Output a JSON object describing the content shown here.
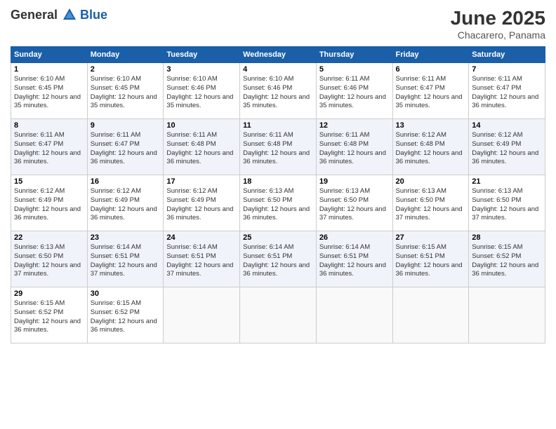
{
  "header": {
    "logo": {
      "general": "General",
      "blue": "Blue"
    },
    "title": "June 2025",
    "location": "Chacarero, Panama"
  },
  "columns": [
    "Sunday",
    "Monday",
    "Tuesday",
    "Wednesday",
    "Thursday",
    "Friday",
    "Saturday"
  ],
  "weeks": [
    [
      {
        "day": "1",
        "sunrise": "Sunrise: 6:10 AM",
        "sunset": "Sunset: 6:45 PM",
        "daylight": "Daylight: 12 hours and 35 minutes."
      },
      {
        "day": "2",
        "sunrise": "Sunrise: 6:10 AM",
        "sunset": "Sunset: 6:45 PM",
        "daylight": "Daylight: 12 hours and 35 minutes."
      },
      {
        "day": "3",
        "sunrise": "Sunrise: 6:10 AM",
        "sunset": "Sunset: 6:46 PM",
        "daylight": "Daylight: 12 hours and 35 minutes."
      },
      {
        "day": "4",
        "sunrise": "Sunrise: 6:10 AM",
        "sunset": "Sunset: 6:46 PM",
        "daylight": "Daylight: 12 hours and 35 minutes."
      },
      {
        "day": "5",
        "sunrise": "Sunrise: 6:11 AM",
        "sunset": "Sunset: 6:46 PM",
        "daylight": "Daylight: 12 hours and 35 minutes."
      },
      {
        "day": "6",
        "sunrise": "Sunrise: 6:11 AM",
        "sunset": "Sunset: 6:47 PM",
        "daylight": "Daylight: 12 hours and 35 minutes."
      },
      {
        "day": "7",
        "sunrise": "Sunrise: 6:11 AM",
        "sunset": "Sunset: 6:47 PM",
        "daylight": "Daylight: 12 hours and 36 minutes."
      }
    ],
    [
      {
        "day": "8",
        "sunrise": "Sunrise: 6:11 AM",
        "sunset": "Sunset: 6:47 PM",
        "daylight": "Daylight: 12 hours and 36 minutes."
      },
      {
        "day": "9",
        "sunrise": "Sunrise: 6:11 AM",
        "sunset": "Sunset: 6:47 PM",
        "daylight": "Daylight: 12 hours and 36 minutes."
      },
      {
        "day": "10",
        "sunrise": "Sunrise: 6:11 AM",
        "sunset": "Sunset: 6:48 PM",
        "daylight": "Daylight: 12 hours and 36 minutes."
      },
      {
        "day": "11",
        "sunrise": "Sunrise: 6:11 AM",
        "sunset": "Sunset: 6:48 PM",
        "daylight": "Daylight: 12 hours and 36 minutes."
      },
      {
        "day": "12",
        "sunrise": "Sunrise: 6:11 AM",
        "sunset": "Sunset: 6:48 PM",
        "daylight": "Daylight: 12 hours and 36 minutes."
      },
      {
        "day": "13",
        "sunrise": "Sunrise: 6:12 AM",
        "sunset": "Sunset: 6:48 PM",
        "daylight": "Daylight: 12 hours and 36 minutes."
      },
      {
        "day": "14",
        "sunrise": "Sunrise: 6:12 AM",
        "sunset": "Sunset: 6:49 PM",
        "daylight": "Daylight: 12 hours and 36 minutes."
      }
    ],
    [
      {
        "day": "15",
        "sunrise": "Sunrise: 6:12 AM",
        "sunset": "Sunset: 6:49 PM",
        "daylight": "Daylight: 12 hours and 36 minutes."
      },
      {
        "day": "16",
        "sunrise": "Sunrise: 6:12 AM",
        "sunset": "Sunset: 6:49 PM",
        "daylight": "Daylight: 12 hours and 36 minutes."
      },
      {
        "day": "17",
        "sunrise": "Sunrise: 6:12 AM",
        "sunset": "Sunset: 6:49 PM",
        "daylight": "Daylight: 12 hours and 36 minutes."
      },
      {
        "day": "18",
        "sunrise": "Sunrise: 6:13 AM",
        "sunset": "Sunset: 6:50 PM",
        "daylight": "Daylight: 12 hours and 36 minutes."
      },
      {
        "day": "19",
        "sunrise": "Sunrise: 6:13 AM",
        "sunset": "Sunset: 6:50 PM",
        "daylight": "Daylight: 12 hours and 37 minutes."
      },
      {
        "day": "20",
        "sunrise": "Sunrise: 6:13 AM",
        "sunset": "Sunset: 6:50 PM",
        "daylight": "Daylight: 12 hours and 37 minutes."
      },
      {
        "day": "21",
        "sunrise": "Sunrise: 6:13 AM",
        "sunset": "Sunset: 6:50 PM",
        "daylight": "Daylight: 12 hours and 37 minutes."
      }
    ],
    [
      {
        "day": "22",
        "sunrise": "Sunrise: 6:13 AM",
        "sunset": "Sunset: 6:50 PM",
        "daylight": "Daylight: 12 hours and 37 minutes."
      },
      {
        "day": "23",
        "sunrise": "Sunrise: 6:14 AM",
        "sunset": "Sunset: 6:51 PM",
        "daylight": "Daylight: 12 hours and 37 minutes."
      },
      {
        "day": "24",
        "sunrise": "Sunrise: 6:14 AM",
        "sunset": "Sunset: 6:51 PM",
        "daylight": "Daylight: 12 hours and 37 minutes."
      },
      {
        "day": "25",
        "sunrise": "Sunrise: 6:14 AM",
        "sunset": "Sunset: 6:51 PM",
        "daylight": "Daylight: 12 hours and 36 minutes."
      },
      {
        "day": "26",
        "sunrise": "Sunrise: 6:14 AM",
        "sunset": "Sunset: 6:51 PM",
        "daylight": "Daylight: 12 hours and 36 minutes."
      },
      {
        "day": "27",
        "sunrise": "Sunrise: 6:15 AM",
        "sunset": "Sunset: 6:51 PM",
        "daylight": "Daylight: 12 hours and 36 minutes."
      },
      {
        "day": "28",
        "sunrise": "Sunrise: 6:15 AM",
        "sunset": "Sunset: 6:52 PM",
        "daylight": "Daylight: 12 hours and 36 minutes."
      }
    ],
    [
      {
        "day": "29",
        "sunrise": "Sunrise: 6:15 AM",
        "sunset": "Sunset: 6:52 PM",
        "daylight": "Daylight: 12 hours and 36 minutes."
      },
      {
        "day": "30",
        "sunrise": "Sunrise: 6:15 AM",
        "sunset": "Sunset: 6:52 PM",
        "daylight": "Daylight: 12 hours and 36 minutes."
      },
      null,
      null,
      null,
      null,
      null
    ]
  ]
}
